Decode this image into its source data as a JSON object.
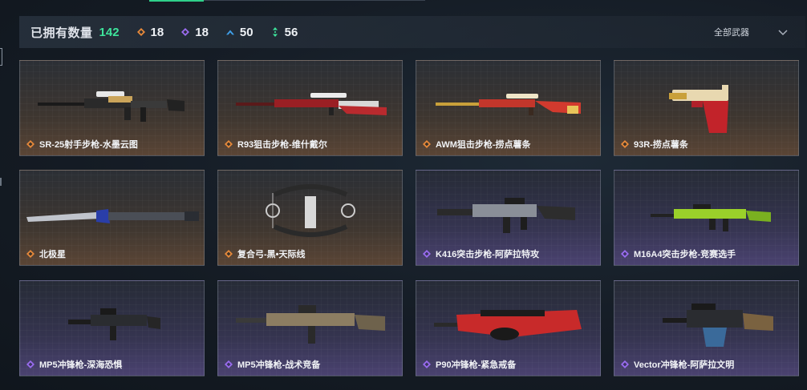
{
  "header": {
    "owned_label": "已拥有数量",
    "owned_count": "142",
    "stats": [
      {
        "icon": "orange-diamond-icon",
        "color": "#e8893a",
        "value": "18"
      },
      {
        "icon": "purple-diamond-icon",
        "color": "#9a6cf0",
        "value": "18"
      },
      {
        "icon": "blue-chevron-icon",
        "color": "#3fa0ea",
        "value": "50"
      },
      {
        "icon": "green-arrows-icon",
        "color": "#3ee39b",
        "value": "56"
      }
    ],
    "filter_label": "全部武器"
  },
  "colors": {
    "accent": "#3ee39b",
    "orange": "#e8893a",
    "purple": "#9a6cf0"
  },
  "weapons": [
    {
      "name": "SR-25射手步枪-水墨云图",
      "rarity": "orange"
    },
    {
      "name": "R93狙击步枪-维什戴尔",
      "rarity": "orange"
    },
    {
      "name": "AWM狙击步枪-捞点薯条",
      "rarity": "orange"
    },
    {
      "name": "93R-捞点薯条",
      "rarity": "orange"
    },
    {
      "name": "北极星",
      "rarity": "orange"
    },
    {
      "name": "复合弓-黑•天际线",
      "rarity": "orange"
    },
    {
      "name": "K416突击步枪-阿萨拉特攻",
      "rarity": "purple"
    },
    {
      "name": "M16A4突击步枪-竞赛选手",
      "rarity": "purple"
    },
    {
      "name": "MP5冲锋枪-深海恐惧",
      "rarity": "purple"
    },
    {
      "name": "MP5冲锋枪-战术竞备",
      "rarity": "purple"
    },
    {
      "name": "P90冲锋枪-紧急戒备",
      "rarity": "purple"
    },
    {
      "name": "Vector冲锋枪-阿萨拉文明",
      "rarity": "purple"
    }
  ]
}
